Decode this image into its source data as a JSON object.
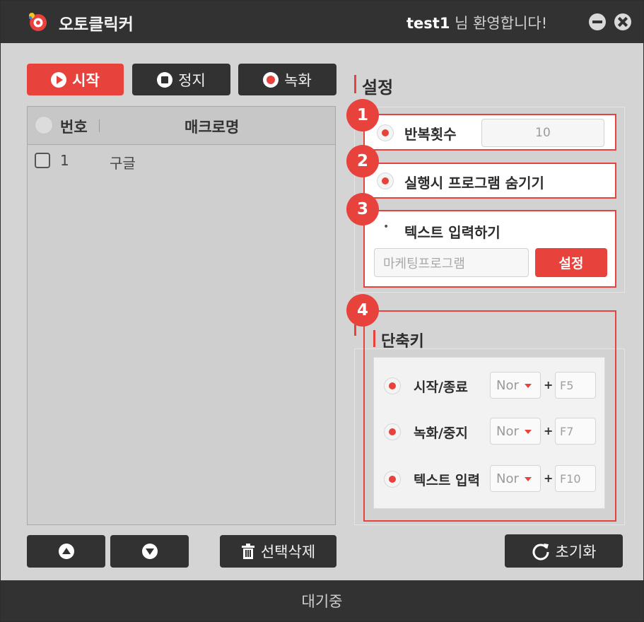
{
  "titlebar": {
    "app_name": "오토클릭커",
    "user": "test1",
    "welcome_suffix": " 님 환영합니다!"
  },
  "toolbar": {
    "start": "시작",
    "stop": "정지",
    "record": "녹화"
  },
  "list": {
    "columns": {
      "number": "번호",
      "macro_name": "매크로명"
    },
    "rows": [
      {
        "number": "1",
        "name": "구글"
      }
    ]
  },
  "bottom": {
    "delete_selected": "선택삭제",
    "reset": "초기화"
  },
  "settings": {
    "title": "설정",
    "badges": [
      "1",
      "2",
      "3",
      "4"
    ],
    "repeat_label": "반복횟수",
    "repeat_value": "10",
    "hide_program_label": "실행시 프로그램 숨기기",
    "text_input_label": "텍스트 입력하기",
    "text_input_placeholder": "마케팅프로그램",
    "set_button": "설정"
  },
  "hotkeys": {
    "title": "단축키",
    "plus": "+",
    "items": [
      {
        "label": "시작/종료",
        "modifier": "Nor",
        "key": "F5"
      },
      {
        "label": "녹화/중지",
        "modifier": "Nor",
        "key": "F7"
      },
      {
        "label": "텍스트 입력",
        "modifier": "Nor",
        "key": "F10"
      }
    ]
  },
  "status": {
    "text": "대기중"
  },
  "colors": {
    "accent": "#e8423d",
    "dark": "#323232",
    "panel": "#d4d4d4"
  }
}
